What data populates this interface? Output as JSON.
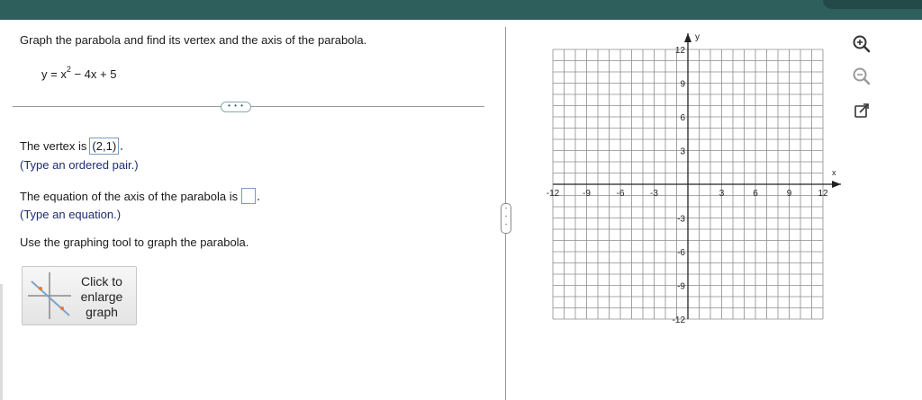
{
  "question": {
    "text": "Graph the parabola and find its vertex and the axis of the parabola."
  },
  "equation": {
    "lhs": "y = x",
    "exponent": "2",
    "rhs": " − 4x + 5"
  },
  "more_button": {
    "label": "• • •"
  },
  "vertex": {
    "prefix": "The vertex is",
    "answer": "(2,1)",
    "hint": "(Type an ordered pair.)"
  },
  "axis": {
    "prefix": "The equation of the axis of the parabola is",
    "hint": "(Type an equation.)"
  },
  "instruction": {
    "text": "Use the graphing tool to graph the parabola."
  },
  "enlarge_button": {
    "label": "Click to enlarge graph"
  },
  "graph": {
    "x_label": "x",
    "y_label": "y",
    "x_ticks": [
      "-12",
      "-9",
      "-6",
      "-3",
      "3",
      "6",
      "9",
      "12"
    ],
    "y_ticks": [
      "12",
      "9",
      "6",
      "3",
      "-3",
      "-6",
      "-9",
      "-12"
    ],
    "range": [
      -12,
      12
    ],
    "grid_step": 1
  },
  "tools": {
    "zoom_in": "zoom-in-icon",
    "zoom_out": "zoom-out-icon",
    "popout": "external-link-icon"
  },
  "colors": {
    "header": "#2e5f5d",
    "answer_border": "#7a9bbf",
    "hint_text": "#1f2d6e"
  }
}
